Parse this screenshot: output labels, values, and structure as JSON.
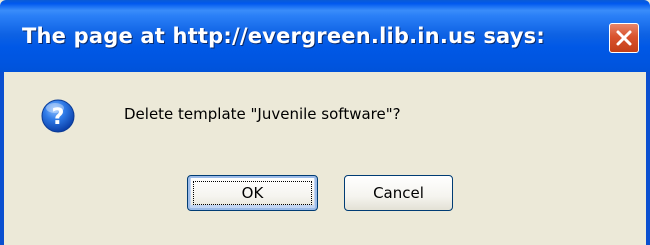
{
  "dialog": {
    "title": "The page at http://evergreen.lib.in.us says:",
    "message": "Delete template \"Juvenile software\"?",
    "icon": "question-icon",
    "close_icon": "close-icon",
    "buttons": {
      "ok_label": "OK",
      "cancel_label": "Cancel"
    },
    "colors": {
      "titlebar": "#0058e6",
      "close_button": "#d9532d",
      "body": "#ece9d8",
      "button_border": "#003c74"
    }
  }
}
